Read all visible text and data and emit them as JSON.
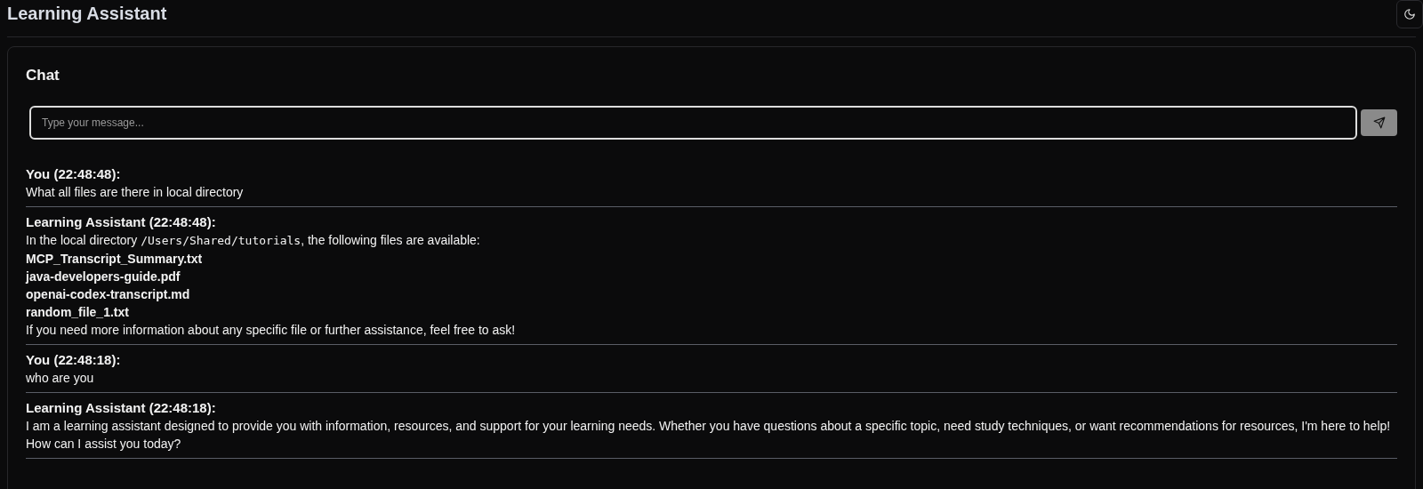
{
  "header": {
    "title": "Learning Assistant"
  },
  "chat": {
    "title": "Chat",
    "input": {
      "placeholder": "Type your message..."
    },
    "messages": [
      {
        "author": "You (22:48:48):",
        "lines": [
          [
            {
              "kind": "text",
              "text": "What all files are there in local directory"
            }
          ]
        ]
      },
      {
        "author": "Learning Assistant (22:48:48):",
        "lines": [
          [
            {
              "kind": "text",
              "text": "In the local directory "
            },
            {
              "kind": "code",
              "text": "/Users/Shared/tutorials"
            },
            {
              "kind": "text",
              "text": ", the following files are available:"
            }
          ],
          [
            {
              "kind": "bold",
              "text": "MCP_Transcript_Summary.txt"
            }
          ],
          [
            {
              "kind": "bold",
              "text": "java-developers-guide.pdf"
            }
          ],
          [
            {
              "kind": "bold",
              "text": "openai-codex-transcript.md"
            }
          ],
          [
            {
              "kind": "bold",
              "text": "random_file_1.txt"
            }
          ],
          [
            {
              "kind": "text",
              "text": "If you need more information about any specific file or further assistance, feel free to ask!"
            }
          ]
        ]
      },
      {
        "author": "You (22:48:18):",
        "lines": [
          [
            {
              "kind": "text",
              "text": "who are you"
            }
          ]
        ]
      },
      {
        "author": "Learning Assistant (22:48:18):",
        "lines": [
          [
            {
              "kind": "text",
              "text": "I am a learning assistant designed to provide you with information, resources, and support for your learning needs. Whether you have questions about a specific topic, need study techniques, or want recommendations for resources, I'm here to help! How can I assist you today?"
            }
          ]
        ]
      }
    ]
  }
}
